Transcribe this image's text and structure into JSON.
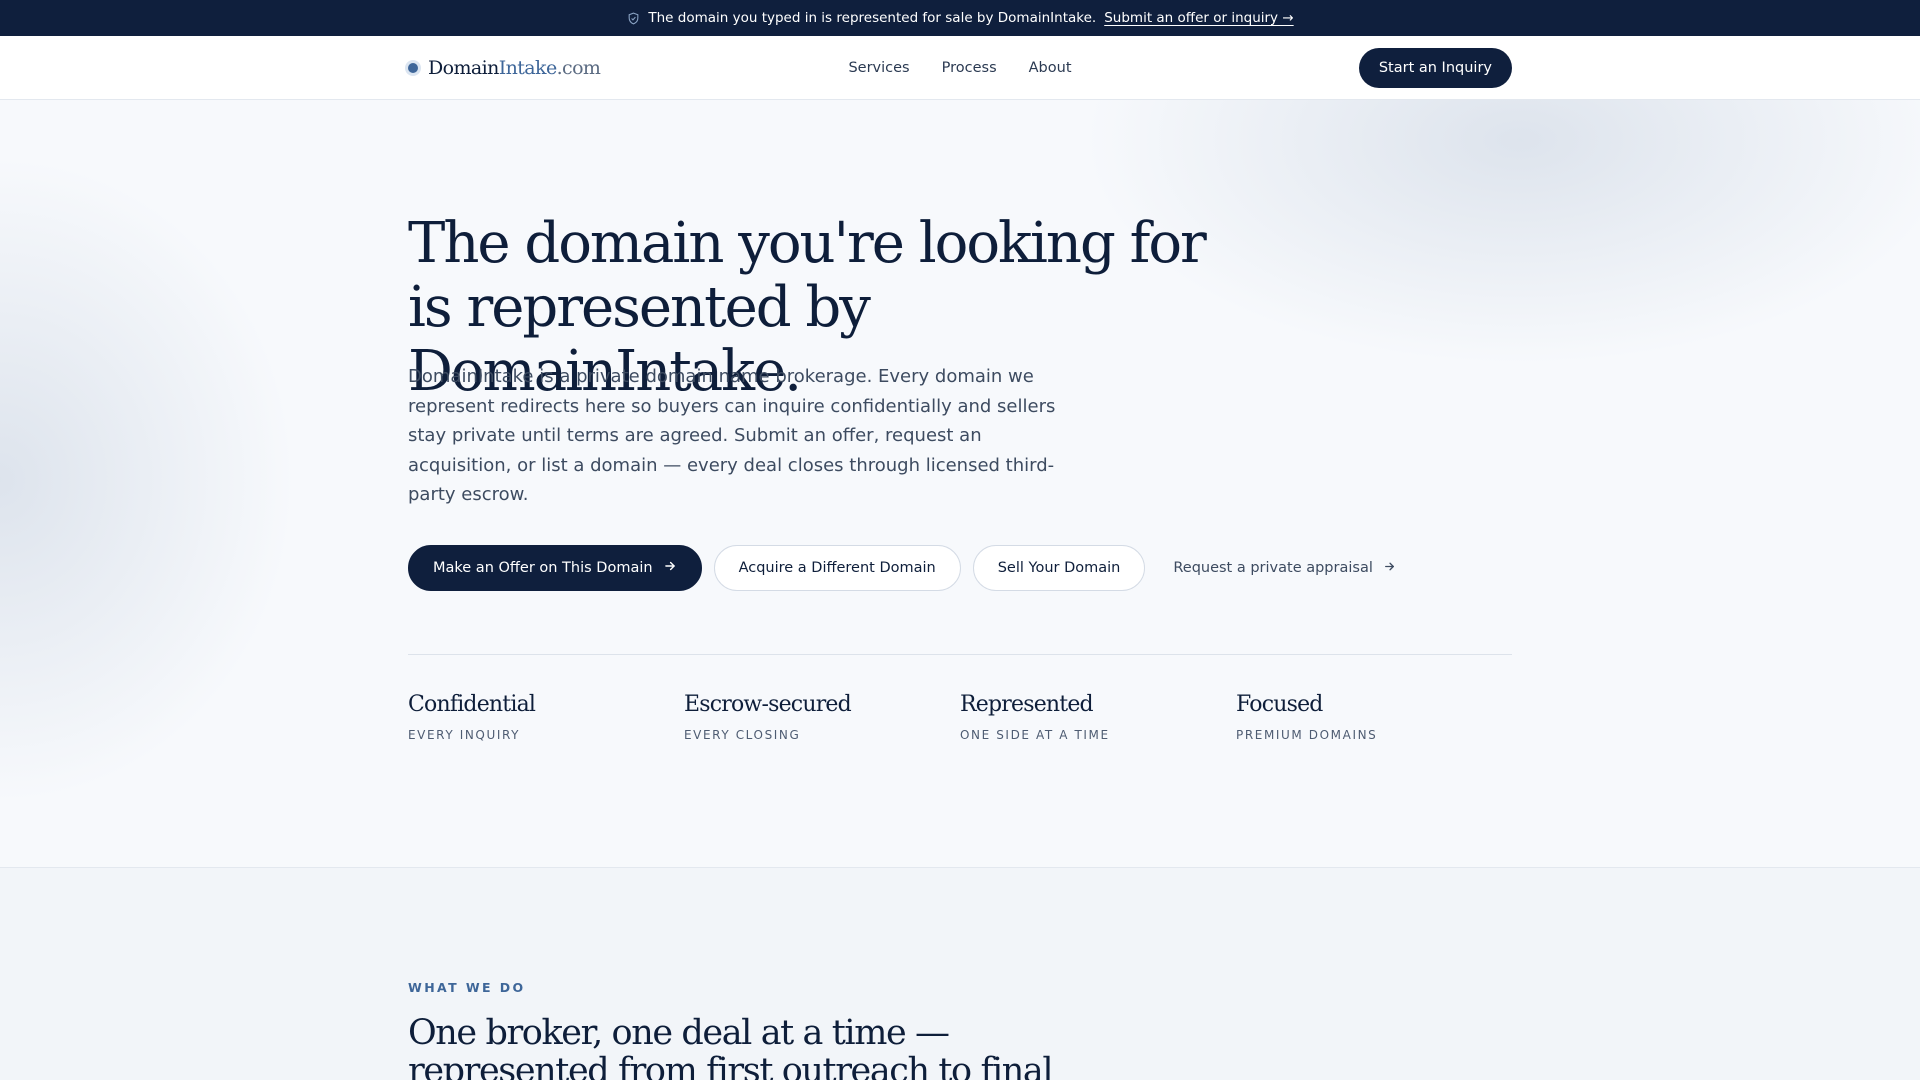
{
  "banner": {
    "text": "The domain you typed in is represented for sale by DomainIntake.",
    "link": "Submit an offer or inquiry →",
    "icon": "shield-check-icon"
  },
  "header": {
    "logo": {
      "part1": "Domain",
      "part2": "Intake",
      "part3": ".com"
    },
    "nav": [
      "Services",
      "Process",
      "About"
    ],
    "cta": "Start an Inquiry"
  },
  "hero": {
    "title": "The domain you're looking for is represented by DomainIntake.",
    "description": "DomainIntake is a private domain name brokerage. Every domain we represent redirects here so buyers can inquire confidentially and sellers stay private until terms are agreed. Submit an offer, request an acquisition, or list a domain — every deal closes through licensed third-party escrow.",
    "buttons": {
      "offer": "Make an Offer on This Domain",
      "acquire": "Acquire a Different Domain",
      "sell": "Sell Your Domain",
      "appraisal": "Request a private appraisal"
    }
  },
  "stats": [
    {
      "title": "Confidential",
      "sub": "EVERY INQUIRY"
    },
    {
      "title": "Escrow-secured",
      "sub": "EVERY CLOSING"
    },
    {
      "title": "Represented",
      "sub": "ONE SIDE AT A TIME"
    },
    {
      "title": "Focused",
      "sub": "PREMIUM DOMAINS"
    }
  ],
  "what_we_do": {
    "eyebrow": "WHAT WE DO",
    "title": "One broker, one deal at a time — represented from first outreach to final transfer."
  },
  "colors": {
    "navy": "#0f1f3d",
    "accent_blue": "#3e6699",
    "background": "#f7f9fc"
  }
}
